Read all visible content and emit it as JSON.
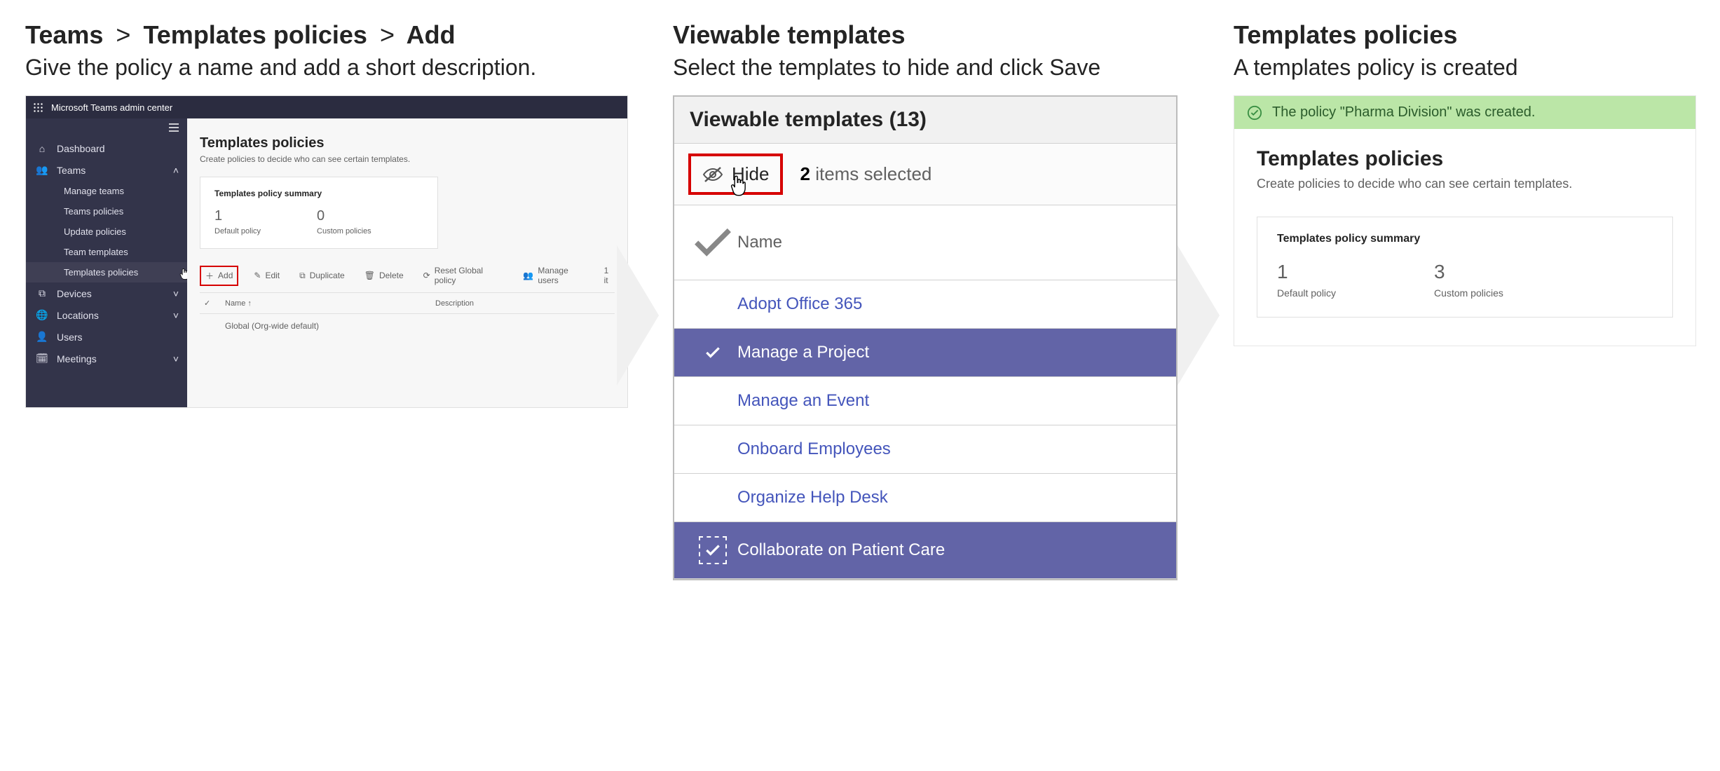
{
  "step1": {
    "crumbs": [
      "Teams",
      "Templates policies",
      "Add"
    ],
    "subtitle": "Give the policy a name and add a short description.",
    "admin": {
      "product_name": "Microsoft Teams admin center",
      "nav": {
        "dashboard": "Dashboard",
        "teams": "Teams",
        "teams_sub": {
          "manage": "Manage teams",
          "teams_policies": "Teams policies",
          "update_policies": "Update policies",
          "team_templates": "Team templates",
          "templates_policies": "Templates policies"
        },
        "devices": "Devices",
        "locations": "Locations",
        "users": "Users",
        "meetings": "Meetings"
      },
      "page": {
        "title": "Templates policies",
        "description": "Create policies to decide who can see certain templates.",
        "card_title": "Templates policy summary",
        "stats": [
          {
            "num": "1",
            "label": "Default policy"
          },
          {
            "num": "0",
            "label": "Custom policies"
          }
        ],
        "toolbar": {
          "add": "Add",
          "edit": "Edit",
          "duplicate": "Duplicate",
          "delete": "Delete",
          "reset": "Reset Global policy",
          "manage": "Manage users",
          "count_label": "1 it"
        },
        "grid": {
          "name_header": "Name ↑",
          "desc_header": "Description",
          "row_name": "Global (Org-wide default)"
        }
      }
    }
  },
  "step2": {
    "title": "Viewable templates",
    "subtitle": "Select the templates to hide and click Save",
    "panel_header": "Viewable templates (13)",
    "hide_label": "Hide",
    "selection_count": "2",
    "selection_label": "items selected",
    "col_name": "Name",
    "rows": [
      {
        "label": "Adopt Office 365",
        "selected": false
      },
      {
        "label": "Manage a Project",
        "selected": true
      },
      {
        "label": "Manage an Event",
        "selected": false
      },
      {
        "label": "Onboard Employees",
        "selected": false
      },
      {
        "label": "Organize Help Desk",
        "selected": false
      },
      {
        "label": "Collaborate on Patient Care",
        "selected": true,
        "dashed": true
      }
    ]
  },
  "step3": {
    "title": "Templates policies",
    "subtitle": "A templates policy is created",
    "banner": "The policy \"Pharma Division\" was created.",
    "page_title": "Templates policies",
    "page_desc": "Create policies to decide who can see certain templates.",
    "card_title": "Templates policy summary",
    "stats": [
      {
        "num": "1",
        "label": "Default policy"
      },
      {
        "num": "3",
        "label": "Custom policies"
      }
    ]
  }
}
